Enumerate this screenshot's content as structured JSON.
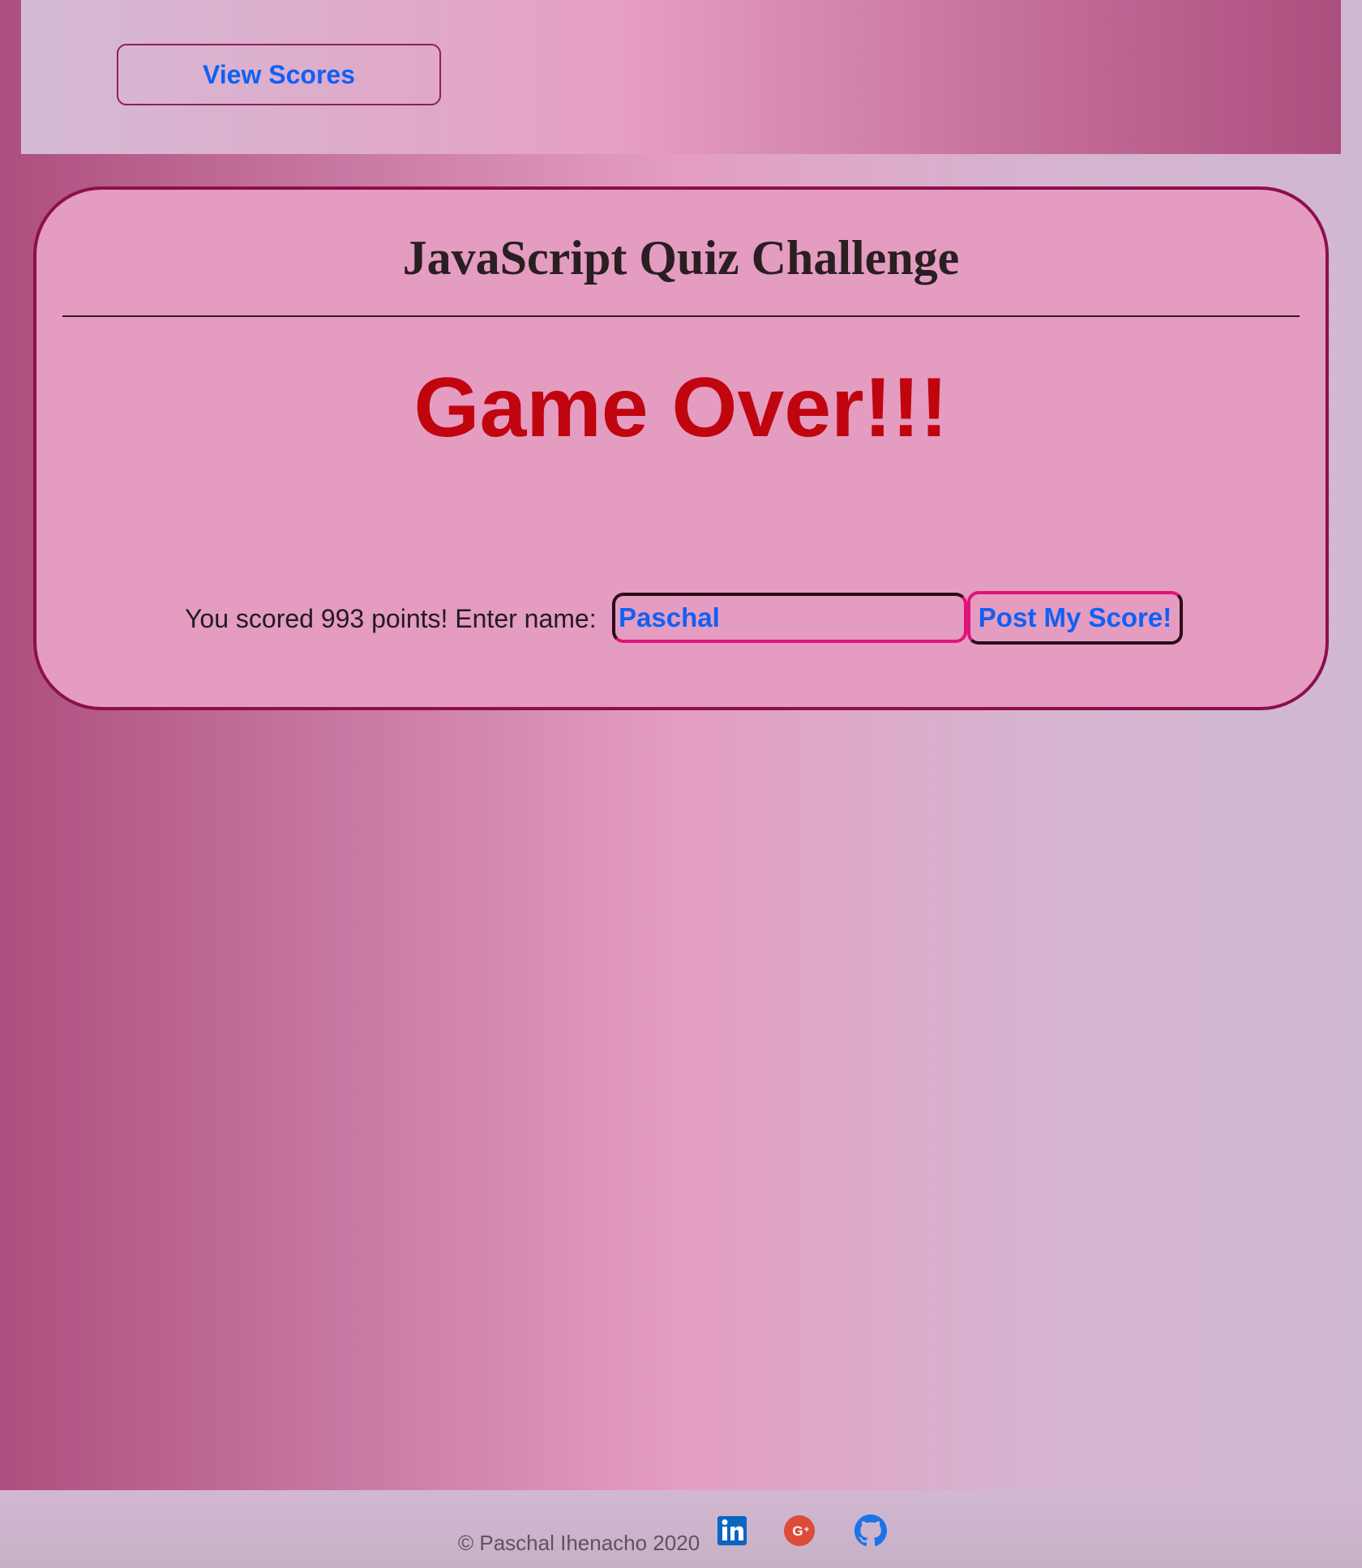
{
  "header": {
    "view_scores_label": "View Scores"
  },
  "quiz": {
    "title": "JavaScript Quiz Challenge",
    "game_over_text": "Game Over!!!",
    "score_prompt": "You scored 993 points! Enter name:",
    "name_value": "Paschal",
    "post_button_label": "Post My Score!"
  },
  "footer": {
    "copyright": "© Paschal Ihenacho 2020",
    "social": [
      {
        "icon": "linkedin-icon",
        "color": "#0a66c2"
      },
      {
        "icon": "google-plus-icon",
        "color": "#dd4b39"
      },
      {
        "icon": "github-icon",
        "color": "#1a73e8"
      }
    ]
  },
  "colors": {
    "accent_text": "#1060f5",
    "game_over": "#c0050f",
    "card_background": "#e49cc0",
    "card_border": "#8d0f4b"
  }
}
